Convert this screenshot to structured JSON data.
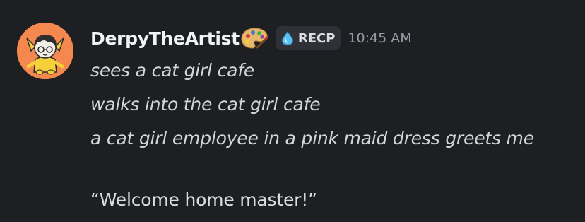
{
  "message": {
    "author": "DerpyTheArtist",
    "author_icon": "artist-palette-icon",
    "role_tag": {
      "icon": "water-drop-icon",
      "label": "RECP"
    },
    "timestamp": "10:45 AM",
    "lines": [
      "sees a cat girl cafe",
      "walks into the cat girl cafe",
      "a cat girl employee in a pink maid dress greets me"
    ],
    "quote": "“Welcome home master!”"
  },
  "colors": {
    "background": "#1e1f22",
    "avatar_bg": "#f4884f",
    "username": "#f2f3f5",
    "timestamp": "#949ba4",
    "role_tag_bg": "#2f3038"
  }
}
